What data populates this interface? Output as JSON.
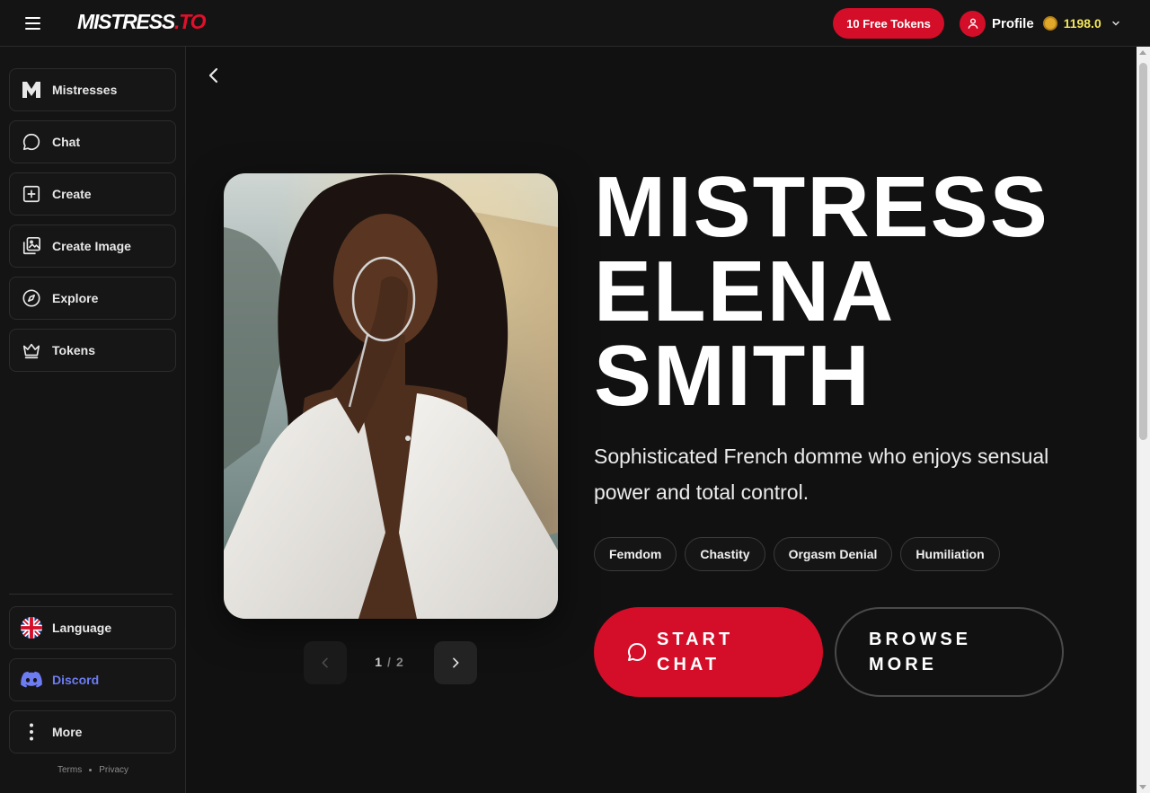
{
  "header": {
    "logo_text": "MISTRESS",
    "logo_accent": ".TO",
    "free_tokens_label": "10 Free Tokens",
    "profile_label": "Profile",
    "token_balance": "1198.0"
  },
  "sidebar": {
    "items": [
      {
        "label": "Mistresses",
        "icon": "m-logo-icon"
      },
      {
        "label": "Chat",
        "icon": "chat-bubble-icon"
      },
      {
        "label": "Create",
        "icon": "plus-square-icon"
      },
      {
        "label": "Create Image",
        "icon": "image-plus-icon"
      },
      {
        "label": "Explore",
        "icon": "compass-icon"
      },
      {
        "label": "Tokens",
        "icon": "crown-icon"
      }
    ],
    "bottom_items": [
      {
        "label": "Language",
        "icon": "uk-flag-icon"
      },
      {
        "label": "Discord",
        "icon": "discord-icon"
      },
      {
        "label": "More",
        "icon": "more-vertical-icon"
      }
    ],
    "footer": {
      "terms": "Terms",
      "privacy": "Privacy"
    }
  },
  "persona": {
    "name": "MISTRESS ELENA SMITH",
    "description": "Sophisticated French domme who enjoys sensual power and total control.",
    "tags": [
      "Femdom",
      "Chastity",
      "Orgasm Denial",
      "Humiliation"
    ],
    "start_chat_label": "START CHAT",
    "browse_more_label": "BROWSE MORE"
  },
  "gallery": {
    "current": "1",
    "separator": "/",
    "total": "2"
  },
  "colors": {
    "brand_red": "#d40d28",
    "background": "#111111",
    "balance_yellow": "#f4e55b",
    "discord": "#6d7cf3"
  }
}
